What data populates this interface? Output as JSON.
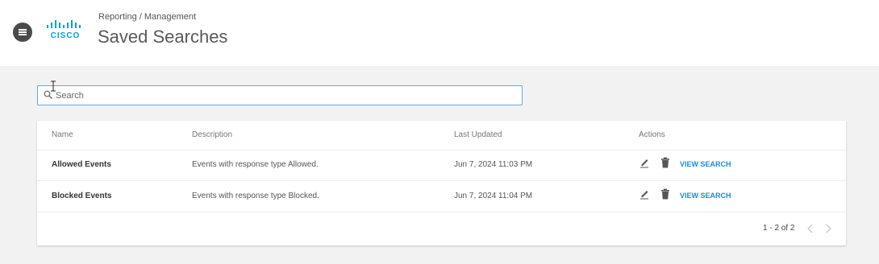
{
  "header": {
    "logo_text": "CISCO",
    "breadcrumb": "Reporting / Management",
    "title": "Saved Searches"
  },
  "search": {
    "placeholder": "Search",
    "value": ""
  },
  "table": {
    "columns": [
      "Name",
      "Description",
      "Last Updated",
      "Actions"
    ],
    "rows": [
      {
        "name": "Allowed Events",
        "description": "Events with response type Allowed.",
        "last_updated": "Jun 7, 2024 11:03 PM",
        "action_label": "VIEW SEARCH"
      },
      {
        "name": "Blocked Events",
        "description": "Events with response type Blocked.",
        "last_updated": "Jun 7, 2024 11:04 PM",
        "action_label": "VIEW SEARCH"
      }
    ]
  },
  "pagination": {
    "label": "1 - 2 of 2"
  },
  "colors": {
    "accent": "#049fd9",
    "link": "#1a8fd1",
    "search_border": "#6aa7d8"
  },
  "icons": [
    "menu-icon",
    "cisco-logo",
    "search-icon",
    "text-cursor-icon",
    "edit-icon",
    "trash-icon",
    "chevron-left-icon",
    "chevron-right-icon"
  ]
}
